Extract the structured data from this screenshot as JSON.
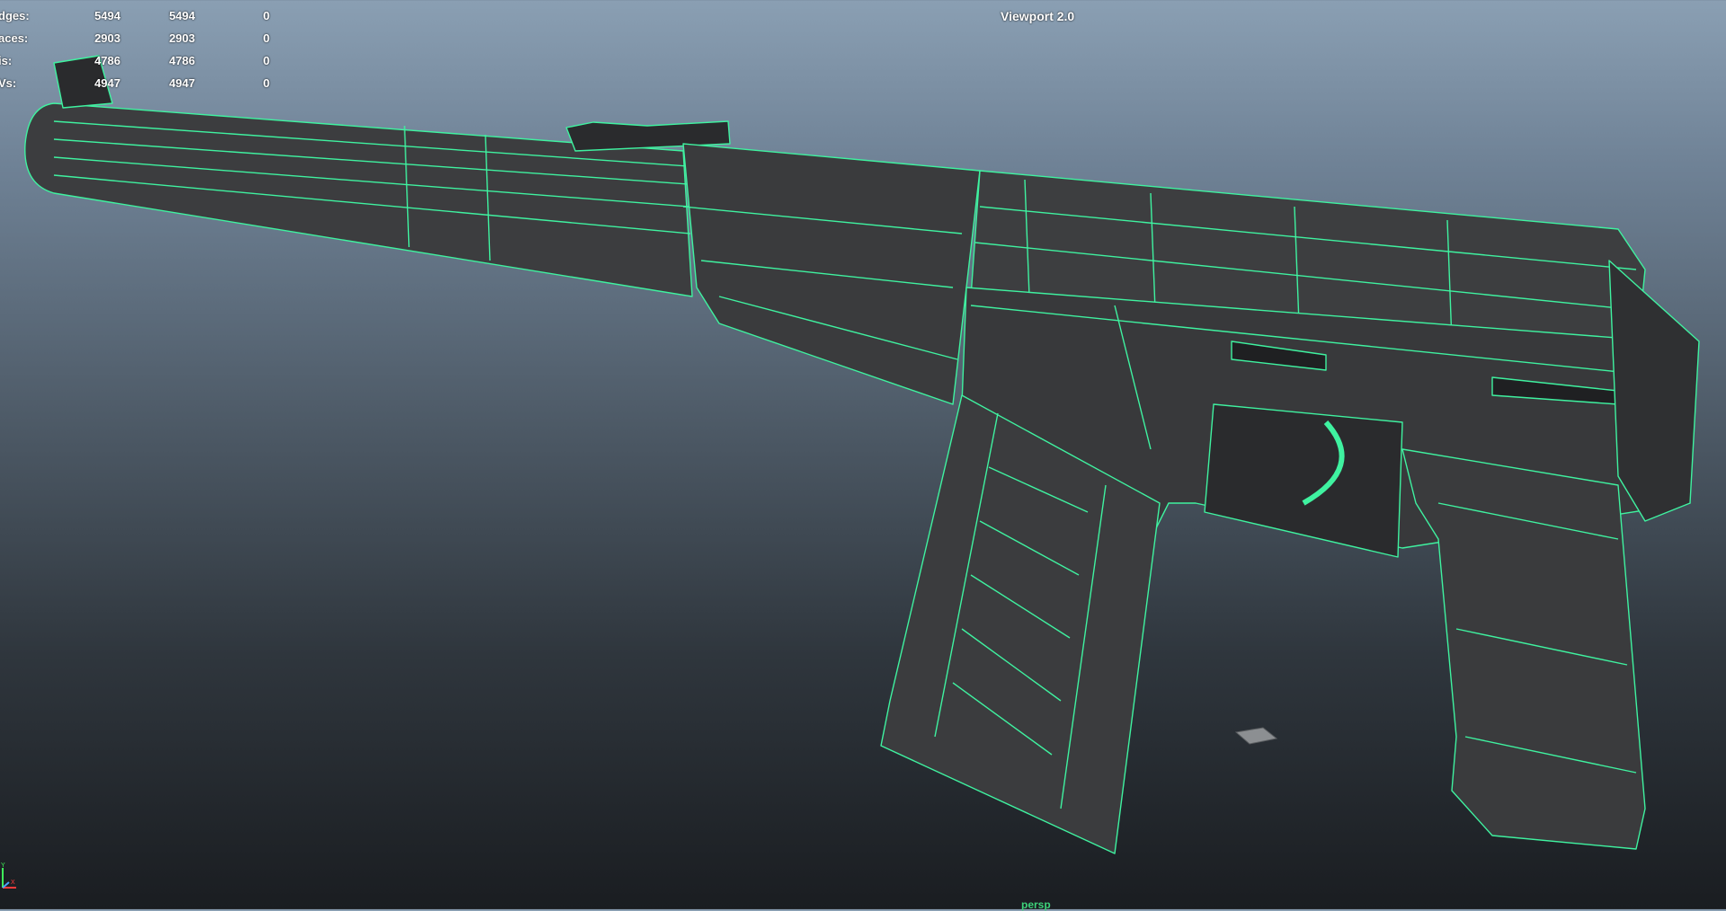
{
  "viewport": {
    "title": "Viewport 2.0",
    "camera": "persp"
  },
  "hud_stats": [
    {
      "label": "dges:",
      "values": [
        "5494",
        "5494",
        "0"
      ]
    },
    {
      "label": "aces:",
      "values": [
        "2903",
        "2903",
        "0"
      ]
    },
    {
      "label": "is:",
      "values": [
        "4786",
        "4786",
        "0"
      ]
    },
    {
      "label": "Vs:",
      "values": [
        "4947",
        "4947",
        "0"
      ]
    }
  ],
  "colors": {
    "wireframe": "#3ff2a0",
    "mesh_fill": "#3c3d3f",
    "mesh_shade": "#2a2b2d",
    "background_top": "#8a9fb3",
    "background_bottom": "#1a1d21"
  },
  "icons": {
    "axis_gizmo": "axis-gizmo-icon",
    "pivot_marker": "pivot-marker-icon"
  }
}
